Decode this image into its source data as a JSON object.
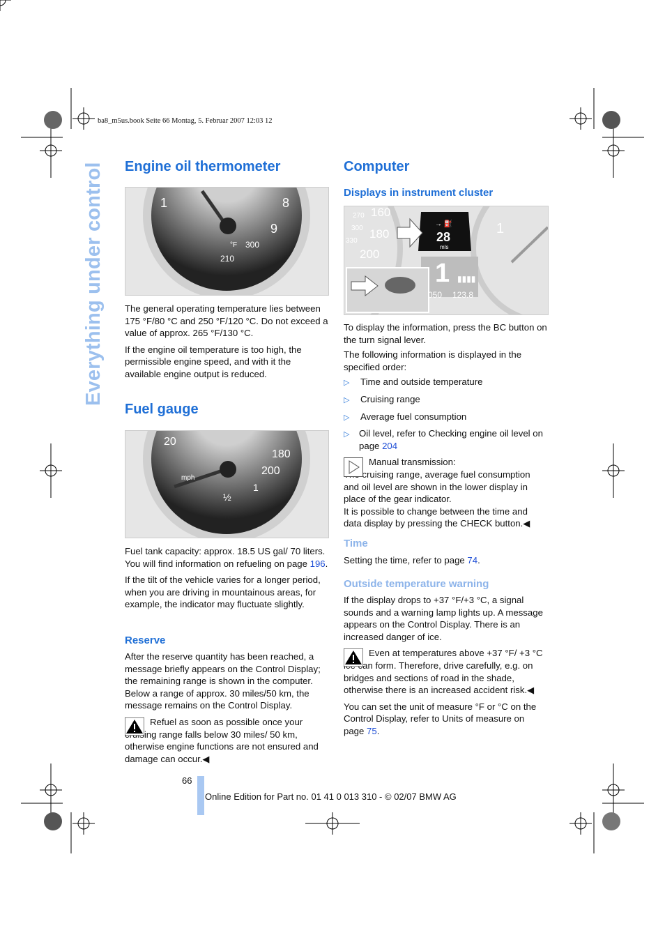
{
  "header": {
    "print_info": "ba8_m5us.book  Seite 66  Montag, 5. Februar 2007  12:03 12"
  },
  "side_tab": "Everything under control",
  "left": {
    "engine_oil": {
      "title": "Engine oil thermometer",
      "gauge_labels": [
        "1",
        "8",
        "9",
        "300",
        "210",
        "°F"
      ],
      "p1": "The general operating temperature lies between 175 °F/80 °C and 250 °F/120 °C. Do not exceed a value of approx. 265 °F/130 °C.",
      "p2": "If the engine oil temperature is too high, the permissible engine speed, and with it the available engine output is reduced."
    },
    "fuel": {
      "title": "Fuel gauge",
      "gauge_labels": [
        "20",
        "180",
        "200",
        "mph",
        "½",
        "1"
      ],
      "p1_a": "Fuel tank capacity: approx. 18.5 US gal/ 70 liters. You will find information on refueling on page ",
      "p1_link": "196",
      "p1_b": ".",
      "p2": "If the tilt of the vehicle varies for a longer period, when you are driving in mountainous areas, for example, the indicator may fluctuate slightly."
    },
    "reserve": {
      "title": "Reserve",
      "p1": "After the reserve quantity has been reached, a message briefly appears on the Control Display; the remaining range is shown in the computer. Below a range of approx. 30 miles/50 km, the message remains on the Control Display.",
      "warning": "Refuel as soon as possible once your cruising range falls below 30 miles/ 50 km, otherwise engine functions are not ensured and damage can occur.◀"
    }
  },
  "right": {
    "computer": {
      "title": "Computer"
    },
    "displays": {
      "title": "Displays in instrument cluster",
      "image_labels": {
        "range": "28",
        "unit": "mls",
        "gear": "1",
        "odo": "050",
        "trip": "123.8",
        "speeds": [
          "160",
          "180",
          "200",
          "270",
          "300",
          "330"
        ]
      },
      "p1": "To display the information, press the BC button on the turn signal lever.",
      "p2": "The following information is displayed in the specified order:",
      "bullets": [
        "Time and outside temperature",
        "Cruising range",
        "Average fuel consumption"
      ],
      "bullet4_a": "Oil level, refer to Checking engine oil level on page ",
      "bullet4_link": "204",
      "note_title": "Manual transmission:",
      "note": "The cruising range, average fuel consumption and oil level are shown in the lower display in place of the gear indicator.",
      "note2": "It is possible to change between the time and data display by pressing the CHECK button.◀"
    },
    "time": {
      "title": "Time",
      "p_a": "Setting the time, refer to page ",
      "p_link": "74",
      "p_b": "."
    },
    "temp": {
      "title": "Outside temperature warning",
      "p1": "If the display drops to +37 °F/+3 °C, a signal sounds and a warning lamp lights up. A message appears on the Control Display. There is an increased danger of ice.",
      "warning": "Even at temperatures above +37 °F/ +3 °C ice can form. Therefore, drive carefully, e.g. on bridges and sections of road in the shade, otherwise there is an increased accident risk.◀",
      "p2_a": "You can set the unit of measure °F or °C on the Control Display, refer to Units of measure on page ",
      "p2_link": "75",
      "p2_b": "."
    }
  },
  "footer": {
    "page_number": "66",
    "edition": "Online Edition for Part no. 01 41 0 013 310 - © 02/07 BMW AG"
  },
  "colors": {
    "heading": "#1f6fd6",
    "subheading_light": "#8db4ea",
    "link": "#1f4fd6"
  }
}
